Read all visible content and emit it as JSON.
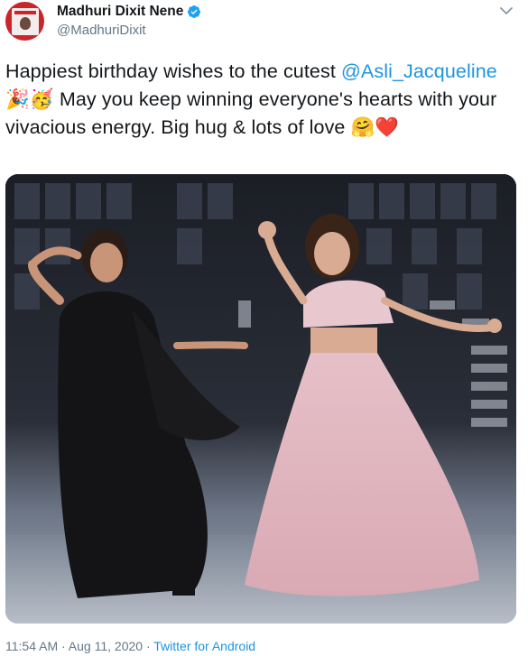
{
  "author": {
    "name": "Madhuri Dixit Nene",
    "handle": "@MadhuriDixit",
    "verified": true
  },
  "tweet": {
    "text_before": "Happiest birthday wishes to the cutest ",
    "mention": "@Asli_Jacqueline",
    "emojis_1": "🎉🥳",
    "text_after": " May you keep winning everyone's hearts with your vivacious energy. Big hug & lots of love ",
    "emojis_2": "🤗❤️"
  },
  "footer": {
    "time": "11:54 AM",
    "separator": " · ",
    "date": "Aug 11, 2020",
    "separator2": " · ",
    "source": "Twitter for Android"
  },
  "colors": {
    "link": "#1b95e0",
    "secondary_text": "#657786",
    "primary_text": "#14171a",
    "verified_badge": "#1da1f2"
  },
  "icons": {
    "verified": "verified-badge-icon",
    "menu": "chevron-down-icon"
  }
}
